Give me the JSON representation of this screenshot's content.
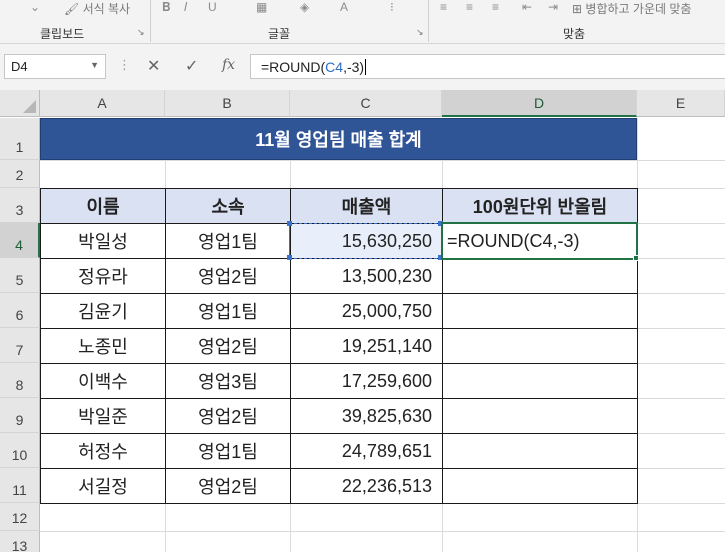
{
  "ribbon": {
    "format_painter": "서식 복사",
    "groups": {
      "clipboard": "클립보드",
      "font": "글꼴",
      "alignment": "맞춤"
    },
    "merge_label": "병합하고 가운데 맞춤"
  },
  "formula_bar": {
    "name_box": "D4",
    "formula_prefix": "=ROUND(",
    "formula_ref": "C4",
    "formula_suffix": ",-3)",
    "cancel_icon": "✕",
    "enter_icon": "✓",
    "fx_icon": "fx"
  },
  "columns": [
    "A",
    "B",
    "C",
    "D",
    "E"
  ],
  "rows": [
    "1",
    "2",
    "3",
    "4",
    "5",
    "6",
    "7",
    "8",
    "9",
    "10",
    "11",
    "12",
    "13"
  ],
  "active_cell": "D4",
  "sheet": {
    "title": "11월 영업팀 매출 합계",
    "headers": {
      "name": "이름",
      "team": "소속",
      "sales": "매출액",
      "rounded": "100원단위 반올림"
    },
    "records": [
      {
        "name": "박일성",
        "team": "영업1팀",
        "sales": "15,630,250",
        "rounded": "=ROUND(C4,-3)"
      },
      {
        "name": "정유라",
        "team": "영업2팀",
        "sales": "13,500,230",
        "rounded": ""
      },
      {
        "name": "김윤기",
        "team": "영업1팀",
        "sales": "25,000,750",
        "rounded": ""
      },
      {
        "name": "노종민",
        "team": "영업2팀",
        "sales": "19,251,140",
        "rounded": ""
      },
      {
        "name": "이백수",
        "team": "영업3팀",
        "sales": "17,259,600",
        "rounded": ""
      },
      {
        "name": "박일준",
        "team": "영업2팀",
        "sales": "39,825,630",
        "rounded": ""
      },
      {
        "name": "허정수",
        "team": "영업1팀",
        "sales": "24,789,651",
        "rounded": ""
      },
      {
        "name": "서길정",
        "team": "영업2팀",
        "sales": "22,236,513",
        "rounded": ""
      }
    ]
  },
  "colors": {
    "title_fill": "#2f5597",
    "header_fill": "#d9e1f2",
    "active_border": "#217346",
    "reference_highlight": "#3a73c9"
  }
}
